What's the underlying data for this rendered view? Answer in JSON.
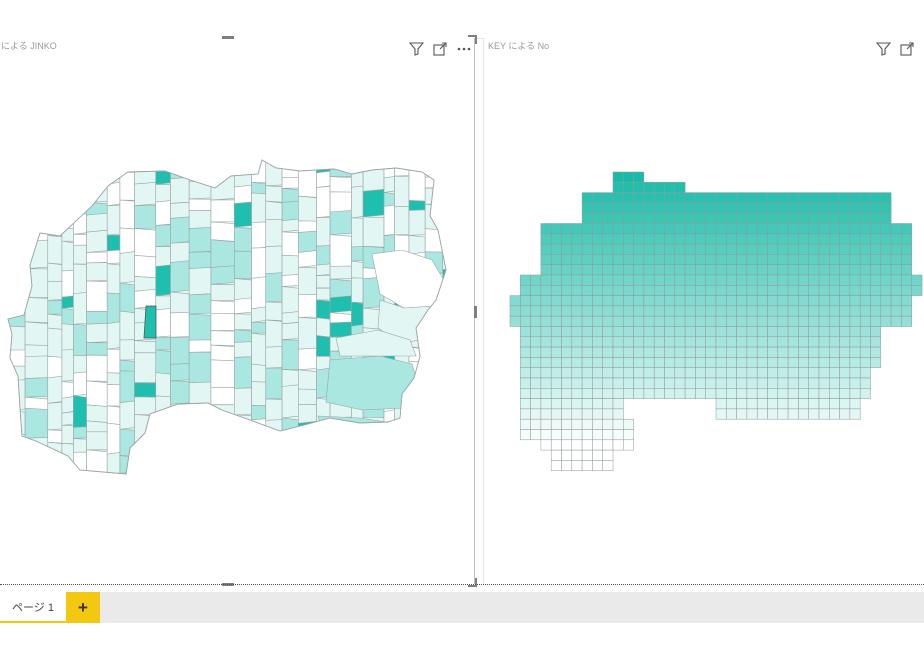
{
  "visuals": [
    {
      "title": "による JINKO",
      "icons": [
        "filter-icon",
        "focus-mode-icon",
        "more-options-icon"
      ],
      "map_colors": {
        "light": "#e2f6f4",
        "mid": "#a9e7e0",
        "dark": "#1fbfb0",
        "stroke": "#9aa6a5"
      }
    },
    {
      "title": "KEY による No",
      "icons": [
        "filter-icon",
        "focus-mode-icon"
      ],
      "grid_colors": {
        "top": "#17bba8",
        "bottom": "#ffffff",
        "stroke": "#8f9b9a"
      }
    }
  ],
  "pages": {
    "tabs": [
      {
        "label": "ページ 1",
        "active": true
      }
    ],
    "add_label": "+",
    "accent": "#f2c811"
  }
}
